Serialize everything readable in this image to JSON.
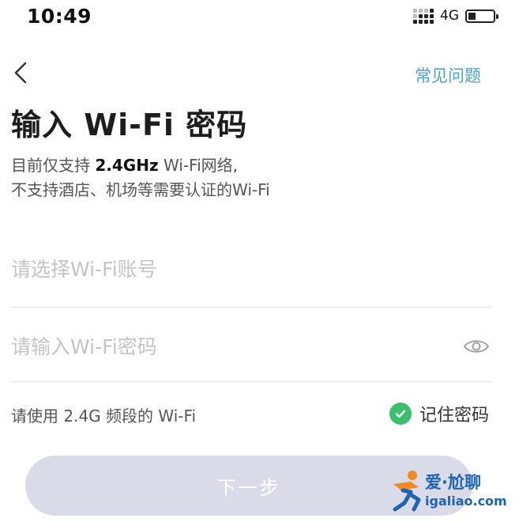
{
  "status_bar": {
    "time": "10:49",
    "network": "4G",
    "battery_level": 0.3
  },
  "header": {
    "back_icon": "chevron-left-icon",
    "faq_label": "常见问题"
  },
  "title": "输入 Wi-Fi 密码",
  "description": {
    "line1_prefix": "目前仅支持 ",
    "line1_highlight": "2.4GHz",
    "line1_suffix": " Wi-Fi网络,",
    "line2": "不支持酒店、机场等需要认证的Wi-Fi"
  },
  "form": {
    "ssid_placeholder": "请选择Wi-Fi账号",
    "ssid_value": "",
    "password_placeholder": "请输入Wi-Fi密码",
    "password_value": "",
    "password_toggle_icon": "eye-icon"
  },
  "hint": "请使用 2.4G 频段的 Wi-Fi",
  "remember": {
    "label": "记住密码",
    "checked": true,
    "icon": "check-circle-icon"
  },
  "next_button_label": "下一步",
  "watermark": {
    "title": "爱·尬聊",
    "subtitle": "igaliao.com"
  },
  "colors": {
    "accent_link": "#4aa3c8",
    "check_green": "#3bbf6a",
    "button_disabled": "#dadbe8",
    "watermark_blue": "#1f64b3",
    "watermark_orange": "#f08a1d"
  }
}
